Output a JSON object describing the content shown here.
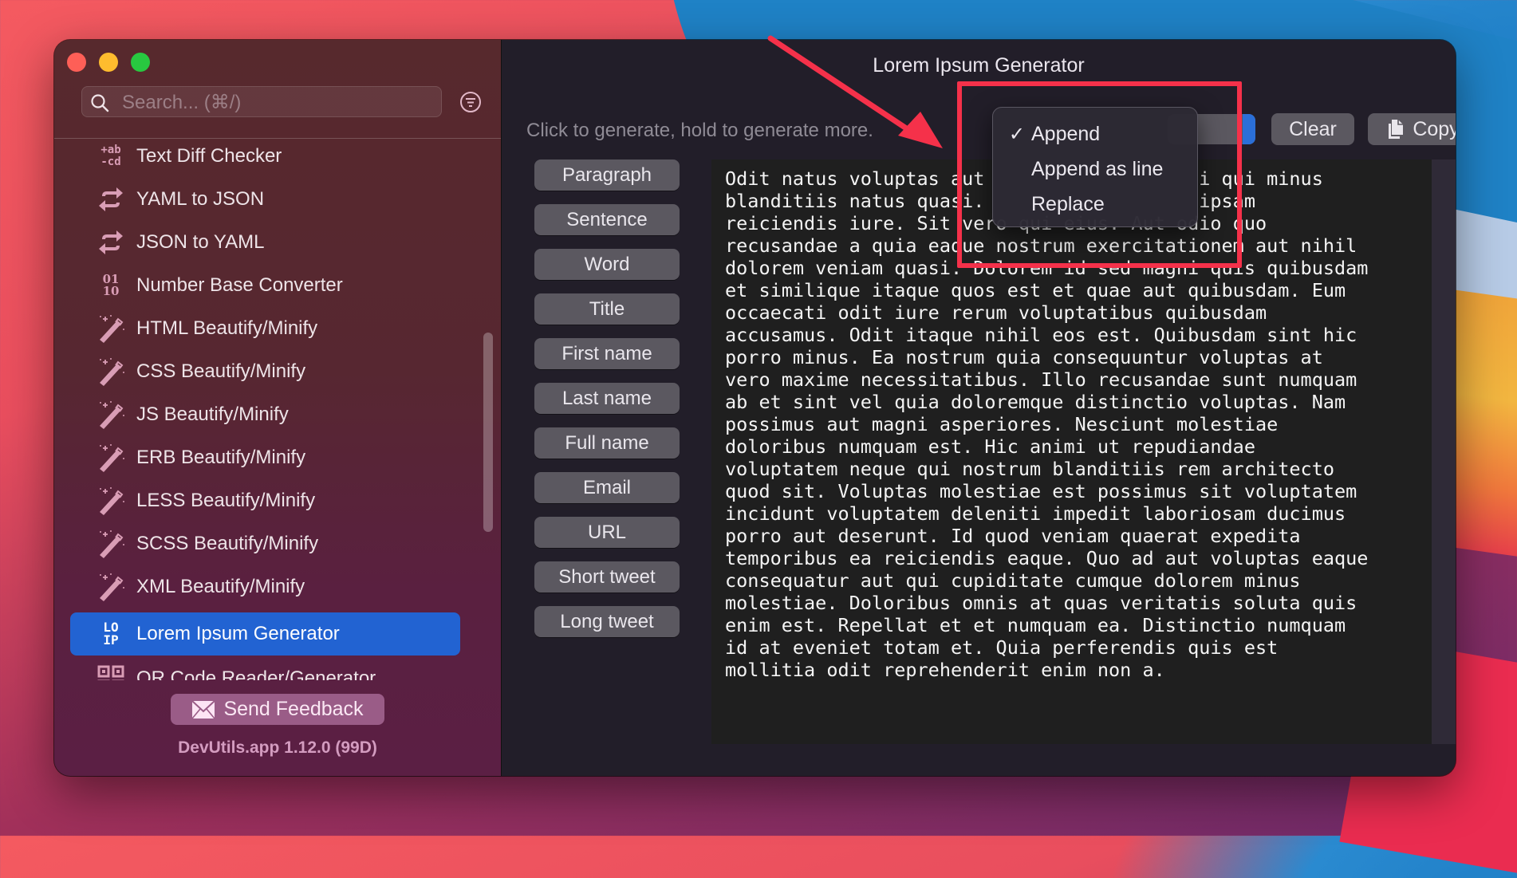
{
  "window": {
    "traffic_lights": [
      "close",
      "minimize",
      "zoom"
    ]
  },
  "sidebar": {
    "search": {
      "placeholder": "Search... (⌘/)",
      "value": ""
    },
    "filter_icon": "filter-icon",
    "items": [
      {
        "label": "Text Diff Checker",
        "icon": "text-diff-icon",
        "icon_text": "+ab\n-cd",
        "selected": false
      },
      {
        "label": "YAML to JSON",
        "icon": "convert-arrows-icon",
        "selected": false
      },
      {
        "label": "JSON to YAML",
        "icon": "convert-arrows-icon",
        "selected": false
      },
      {
        "label": "Number Base Converter",
        "icon": "number-base-icon",
        "icon_text": "01\n10",
        "selected": false
      },
      {
        "label": "HTML Beautify/Minify",
        "icon": "magic-wand-icon",
        "selected": false
      },
      {
        "label": "CSS Beautify/Minify",
        "icon": "magic-wand-icon",
        "selected": false
      },
      {
        "label": "JS Beautify/Minify",
        "icon": "magic-wand-icon",
        "selected": false
      },
      {
        "label": "ERB Beautify/Minify",
        "icon": "magic-wand-icon",
        "selected": false
      },
      {
        "label": "LESS Beautify/Minify",
        "icon": "magic-wand-icon",
        "selected": false
      },
      {
        "label": "SCSS Beautify/Minify",
        "icon": "magic-wand-icon",
        "selected": false
      },
      {
        "label": "XML Beautify/Minify",
        "icon": "magic-wand-icon",
        "selected": false
      },
      {
        "label": "Lorem Ipsum Generator",
        "icon": "lorem-ipsum-icon",
        "icon_text": "LO\nIP",
        "selected": true
      },
      {
        "label": "QR Code Reader/Generator",
        "icon": "qr-code-icon",
        "selected": false
      }
    ],
    "feedback_button": "Send Feedback",
    "version": "DevUtils.app 1.12.0 (99D)"
  },
  "main": {
    "title": "Lorem Ipsum Generator",
    "hint": "Click to generate, hold to generate more.",
    "generate_buttons": [
      "Paragraph",
      "Sentence",
      "Word",
      "Title",
      "First name",
      "Last name",
      "Full name",
      "Email",
      "URL",
      "Short tweet",
      "Long tweet"
    ],
    "mode_menu": {
      "selected": "Append",
      "options": [
        "Append",
        "Append as line",
        "Replace"
      ]
    },
    "clear_button": "Clear",
    "copy_button": "Copy",
    "output_lines": [
      "Odit natus voluptas aut                   i qui minus",
      "blanditiis natus quasi.                   ipsam",
      "reiciendis iure. Sit vero qui eius. Aut odio quo",
      "recusandae a quia eaque nostrum exercitationem aut nihil",
      "dolorem veniam quasi. Dolorem id sed magni quis quibusdam",
      "et similique itaque quos est et quae aut quibusdam. Eum",
      "occaecati odit iure rerum voluptatibus quibusdam",
      "accusamus. Odit itaque nihil eos est. Quibusdam sint hic",
      "porro minus. Ea nostrum quia consequuntur voluptas at",
      "vero maxime necessitatibus. Illo recusandae sunt numquam",
      "ab et sint vel quia doloremque distinctio voluptas. Nam",
      "possimus aut magni asperiores. Nesciunt molestiae",
      "doloribus numquam est. Hic animi ut repudiandae",
      "voluptatem neque qui nostrum blanditiis rem architecto",
      "quod sit. Voluptas molestiae est possimus sit voluptatem",
      "incidunt voluptatem deleniti impedit laboriosam ducimus",
      "porro aut deserunt. Id quod veniam quaerat expedita",
      "temporibus ea reiciendis eaque. Quo ad aut voluptas eaque",
      "consequatur aut qui cupiditate cumque dolorem minus",
      "molestiae. Doloribus omnis at quas veritatis soluta quis",
      "enim est. Repellat et et numquam ea. Distinctio numquam",
      "id at eveniet totam et. Quia perferendis quis est",
      "mollitia odit reprehenderit enim non a."
    ]
  },
  "annotation": {
    "color": "#f5314a",
    "shapes": [
      "arrow",
      "highlight-rectangle"
    ]
  },
  "colors": {
    "selected_item": "#2263d2",
    "button": "#5b5860",
    "feedback_button": "#9a5c87"
  }
}
